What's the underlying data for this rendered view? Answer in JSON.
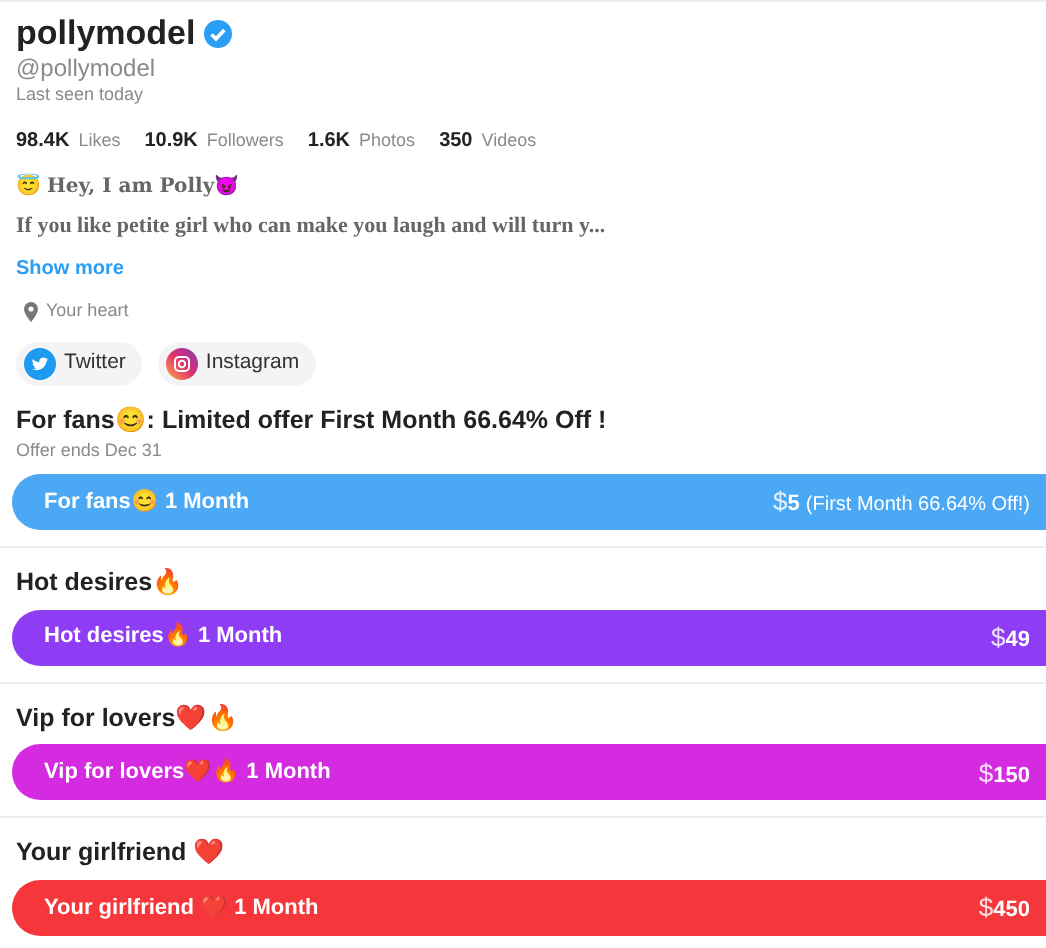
{
  "profile": {
    "name": "pollymodel",
    "verified": true,
    "handle": "@pollymodel",
    "last_seen": "Last seen today",
    "stats": [
      "**98.4K** Likes",
      "**10.9K** Followers",
      "**1.6K** Photos",
      "**350** Videos"
    ],
    "bio_title": "😇 Hey, I am Polly😈",
    "bio": "If you like petite girl who can make you laugh and will turn y...",
    "show_more": "Show more",
    "location": "Your heart",
    "socials": [
      {
        "kind": "twitter",
        "label": "Twitter"
      },
      {
        "kind": "instagram",
        "label": "Instagram"
      }
    ]
  },
  "plans": [
    {
      "title": "For fans😊: Limited offer First Month 66.64% Off !",
      "subtitle": "Offer ends Dec 31",
      "label": "For fans😊 1 Month",
      "currency": "$",
      "price": "5",
      "note": "(First Month 66.64% Off!)",
      "color": "#4aa8f5"
    },
    {
      "title": "Hot desires🔥",
      "label": "Hot desires🔥 1 Month",
      "currency": "$",
      "price": "49",
      "color": "#8f3cf5"
    },
    {
      "title": "Vip for lovers❤️🔥",
      "label": "Vip for lovers❤️🔥 1 Month",
      "currency": "$",
      "price": "150",
      "color": "#d42be0"
    },
    {
      "title": "Your girlfriend ❤️",
      "label": "Your girlfriend ❤️ 1 Month",
      "currency": "$",
      "price": "450",
      "color": "#f5373c"
    }
  ]
}
